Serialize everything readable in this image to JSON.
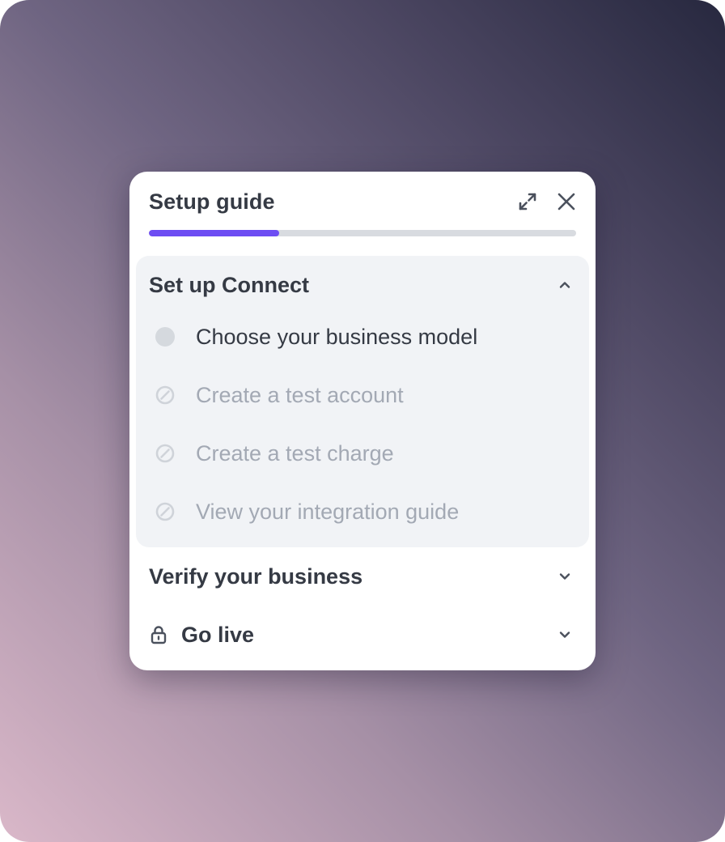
{
  "guide": {
    "title": "Setup guide",
    "progress_fraction": 0.305,
    "accent_color": "#6d4df3",
    "header_icons": [
      "expand-icon",
      "close-icon"
    ]
  },
  "sections": [
    {
      "title": "Set up Connect",
      "state": "expanded",
      "chevron": "chevron-up-icon",
      "tasks": [
        {
          "label": "Choose your business model",
          "status": "pending",
          "icon": "empty-circle-icon"
        },
        {
          "label": "Create a test account",
          "status": "disabled",
          "icon": "blocked-icon"
        },
        {
          "label": "Create a test charge",
          "status": "disabled",
          "icon": "blocked-icon"
        },
        {
          "label": "View your integration guide",
          "status": "disabled",
          "icon": "blocked-icon"
        }
      ]
    },
    {
      "title": "Verify your business",
      "state": "collapsed",
      "chevron": "chevron-down-icon"
    },
    {
      "title": "Go live",
      "state": "collapsed",
      "locked": true,
      "icon": "lock-icon",
      "chevron": "chevron-down-icon"
    }
  ]
}
